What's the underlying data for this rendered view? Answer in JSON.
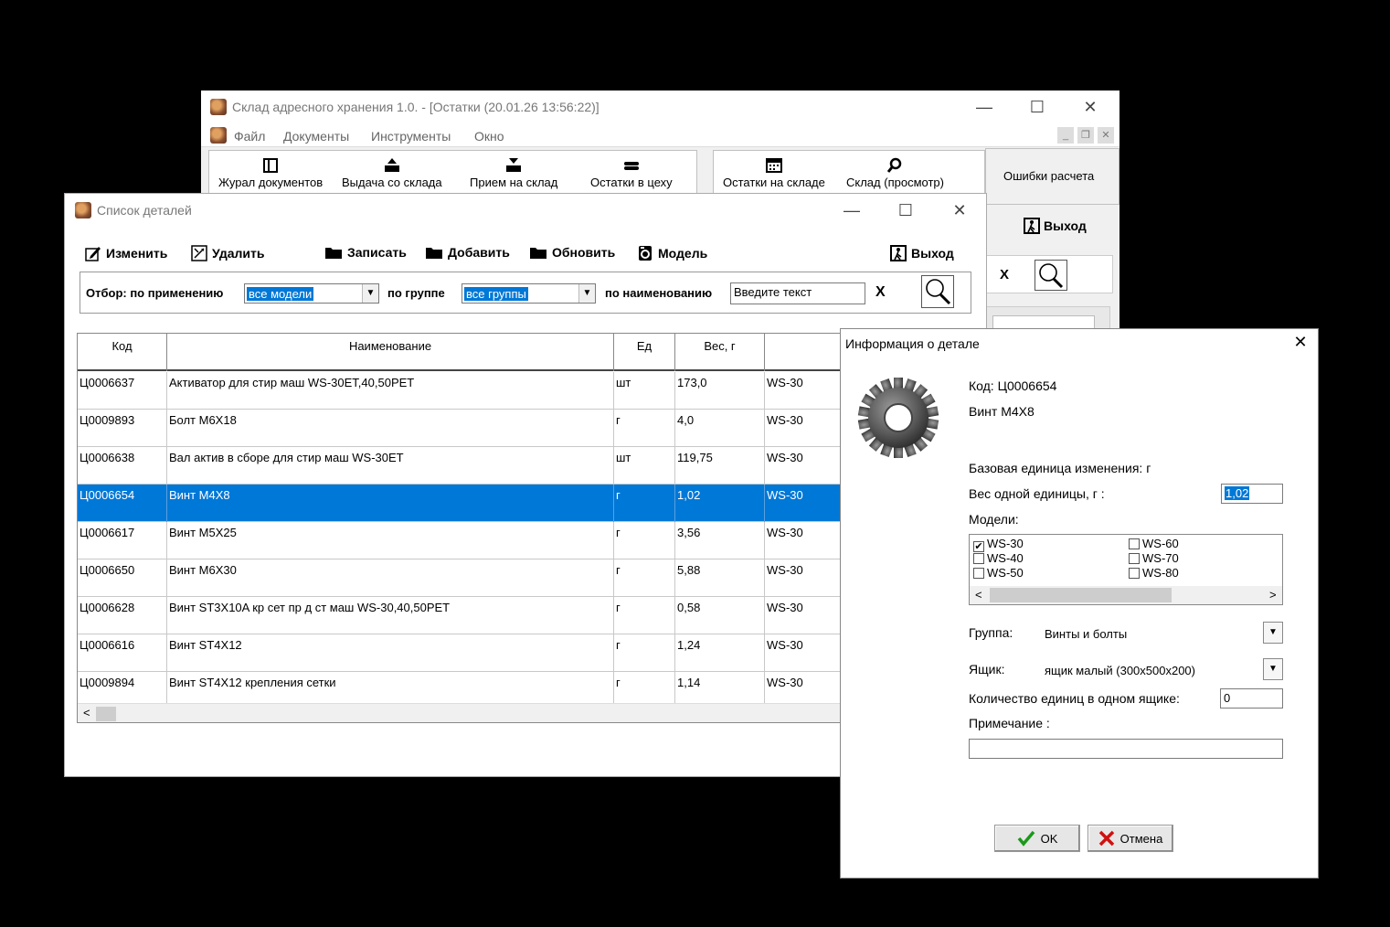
{
  "main_window": {
    "title": "Склад адресного хранения 1.0. - [Остатки (20.01.26 13:56:22)]",
    "menu": [
      "Файл",
      "Документы",
      "Инструменты",
      "Окно"
    ],
    "toolbar": [
      "Журал документов",
      "Выдача со склада",
      "Прием на склад",
      "Остатки в цеху",
      "Остатки на складе",
      "Склад (просмотр)"
    ],
    "errors_button": "Ошибки расчета",
    "exit_button": "Выход",
    "clear_x": "X"
  },
  "parts_window": {
    "title": "Список деталей",
    "actions": {
      "edit": "Изменить",
      "delete": "Удалить",
      "save": "Записать",
      "add": "Добавить",
      "refresh": "Обновить",
      "model": "Модель",
      "exit": "Выход"
    },
    "filter": {
      "label_apply": "Отбор: по применению",
      "models_value": "все модели",
      "label_group": "по группе",
      "groups_value": "все группы",
      "label_name": "по наименованию",
      "name_placeholder": "Введите текст",
      "clear": "X"
    },
    "columns": [
      "Код",
      "Наименование",
      "Ед",
      "Вес, г"
    ],
    "rows": [
      {
        "code": "Ц0006637",
        "name": "Активатор для стир маш WS-30ET,40,50PET",
        "unit": "шт",
        "weight": "173,0",
        "model": "WS-30"
      },
      {
        "code": "Ц0009893",
        "name": "Болт М6Х18",
        "unit": "г",
        "weight": "4,0",
        "model": "WS-30"
      },
      {
        "code": "Ц0006638",
        "name": "Вал актив в сборе для стир маш  WS-30ET",
        "unit": "шт",
        "weight": "119,75",
        "model": "WS-30"
      },
      {
        "code": "Ц0006654",
        "name": "Винт М4Х8",
        "unit": "г",
        "weight": "1,02",
        "model": "WS-30"
      },
      {
        "code": "Ц0006617",
        "name": "Винт М5Х25",
        "unit": "г",
        "weight": "3,56",
        "model": "WS-30"
      },
      {
        "code": "Ц0006650",
        "name": "Винт М6Х30",
        "unit": "г",
        "weight": "5,88",
        "model": "WS-30"
      },
      {
        "code": "Ц0006628",
        "name": "Винт ST3X10A кр сет пр д ст маш  WS-30,40,50PET",
        "unit": "г",
        "weight": "0,58",
        "model": "WS-30"
      },
      {
        "code": "Ц0006616",
        "name": "Винт ST4X12",
        "unit": "г",
        "weight": "1,24",
        "model": "WS-30"
      },
      {
        "code": "Ц0009894",
        "name": "Винт ST4X12 крепления сетки",
        "unit": "г",
        "weight": "1,14",
        "model": "WS-30"
      }
    ],
    "selected_index": 3
  },
  "info_dialog": {
    "title": "Информация о детале",
    "code_line": "Код: Ц0006654",
    "name_line": "Винт М4Х8",
    "base_unit": "Базовая единица изменения: г",
    "weight_label": "Вес одной единицы, г :",
    "weight_value": "1,02",
    "models_label": "Модели:",
    "models": [
      {
        "name": "WS-30",
        "checked": true
      },
      {
        "name": "WS-40",
        "checked": false
      },
      {
        "name": "WS-50",
        "checked": false
      },
      {
        "name": "WS-60",
        "checked": false
      },
      {
        "name": "WS-70",
        "checked": false
      },
      {
        "name": "WS-80",
        "checked": false
      }
    ],
    "group_label": "Группа:",
    "group_value": "Винты и болты",
    "box_label": "Ящик:",
    "box_value": "ящик малый (300x500x200)",
    "qty_label": "Количество единиц в одном ящике:",
    "qty_value": "0",
    "note_label": "Примечание :",
    "note_value": "",
    "ok": "OK",
    "cancel": "Отмена"
  }
}
